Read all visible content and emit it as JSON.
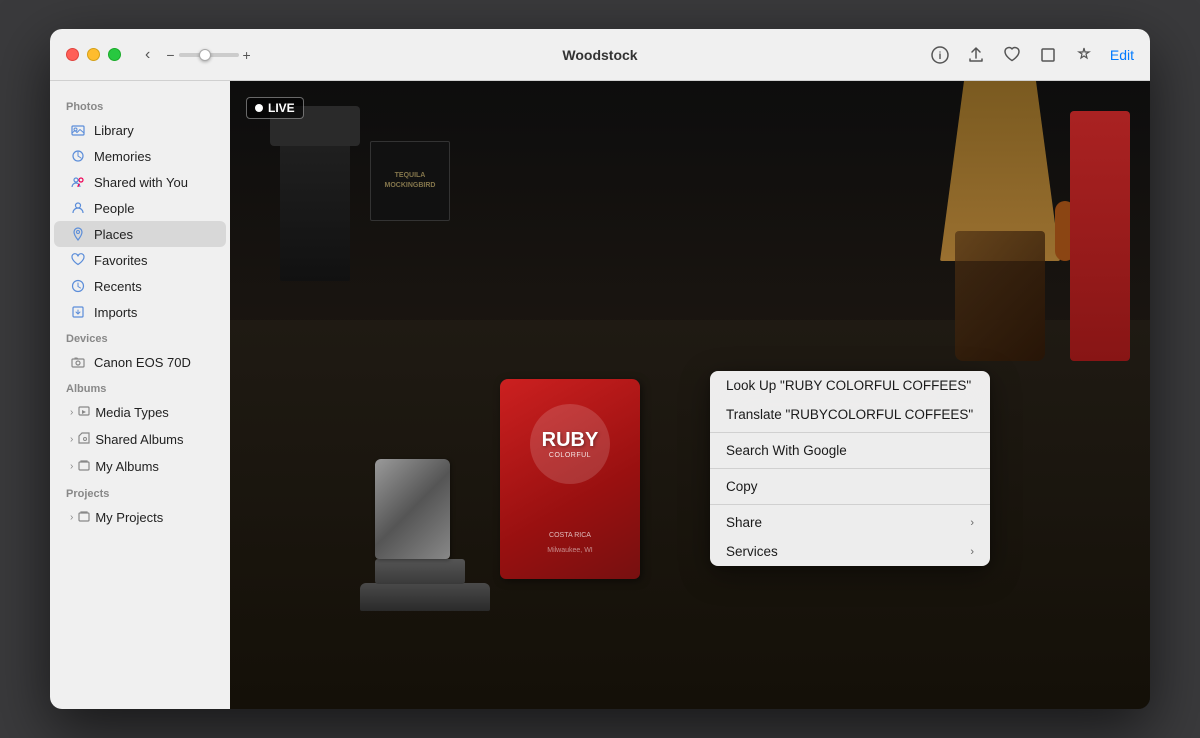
{
  "window": {
    "title": "Woodstock"
  },
  "titlebar": {
    "back_label": "‹",
    "zoom_minus": "−",
    "zoom_plus": "+",
    "edit_label": "Edit",
    "icons": {
      "info": "ⓘ",
      "share": "⬆",
      "heart": "♡",
      "crop": "⊡",
      "magic": "✦"
    }
  },
  "sidebar": {
    "photos_label": "Photos",
    "items_photos": [
      {
        "id": "library",
        "label": "Library",
        "icon": "📷"
      },
      {
        "id": "memories",
        "label": "Memories",
        "icon": "🔮"
      },
      {
        "id": "shared-with-you",
        "label": "Shared with You",
        "icon": "👥"
      },
      {
        "id": "people",
        "label": "People",
        "icon": "👤"
      },
      {
        "id": "places",
        "label": "Places",
        "icon": "📍",
        "active": true
      },
      {
        "id": "favorites",
        "label": "Favorites",
        "icon": "♡"
      },
      {
        "id": "recents",
        "label": "Recents",
        "icon": "🕐"
      },
      {
        "id": "imports",
        "label": "Imports",
        "icon": "⬇"
      }
    ],
    "devices_label": "Devices",
    "items_devices": [
      {
        "id": "canon-eos-70d",
        "label": "Canon EOS 70D",
        "icon": "📷"
      }
    ],
    "albums_label": "Albums",
    "items_albums": [
      {
        "id": "media-types",
        "label": "Media Types",
        "icon": "📁"
      },
      {
        "id": "shared-albums",
        "label": "Shared Albums",
        "icon": "📤"
      },
      {
        "id": "my-albums",
        "label": "My Albums",
        "icon": "📁"
      }
    ],
    "projects_label": "Projects",
    "items_projects": [
      {
        "id": "my-projects",
        "label": "My Projects",
        "icon": "📁"
      }
    ]
  },
  "live_badge": "LIVE",
  "context_menu": {
    "items": [
      {
        "id": "look-up",
        "label": "Look Up \"RUBY COLORFUL COFFEES\"",
        "has_arrow": false
      },
      {
        "id": "translate",
        "label": "Translate \"RUBYCOLORFUL COFFEES\"",
        "has_arrow": false
      },
      {
        "id": "separator1",
        "type": "separator"
      },
      {
        "id": "search-google",
        "label": "Search With Google",
        "has_arrow": false
      },
      {
        "id": "separator2",
        "type": "separator"
      },
      {
        "id": "copy",
        "label": "Copy",
        "has_arrow": false
      },
      {
        "id": "separator3",
        "type": "separator"
      },
      {
        "id": "share",
        "label": "Share",
        "has_arrow": true
      },
      {
        "id": "services",
        "label": "Services",
        "has_arrow": true
      }
    ]
  },
  "coffee_bag": {
    "brand": "RUBY",
    "sub": "COLORFUL",
    "micro": "Milwaukee, WI",
    "origin": "COSTA RICA"
  }
}
